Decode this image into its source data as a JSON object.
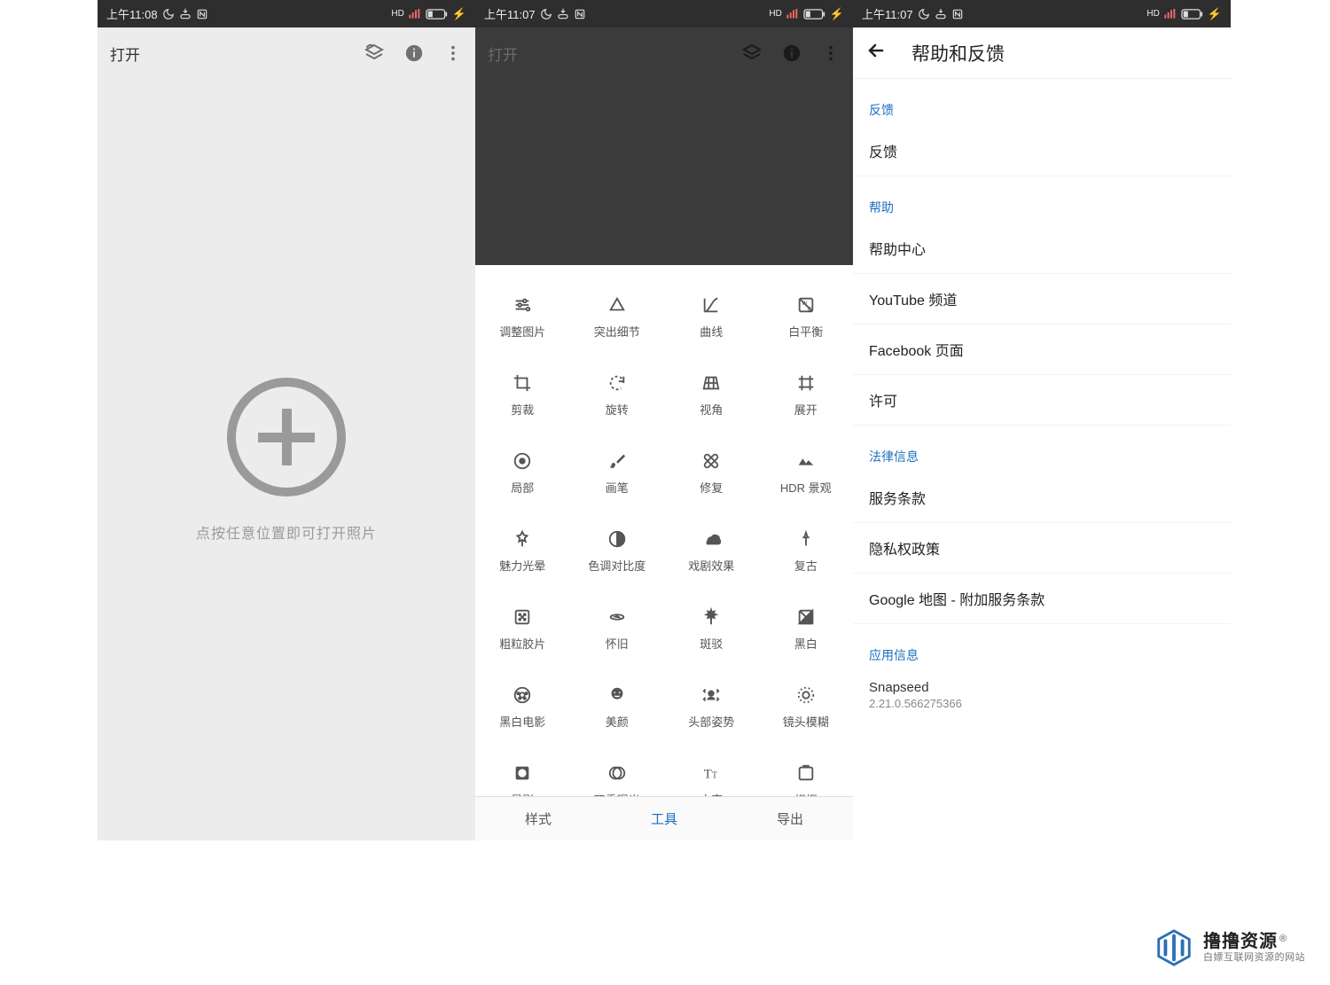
{
  "statusbar": {
    "time1": "上午11:08",
    "time2": "上午11:07",
    "time3": "上午11:07",
    "hd": "HD",
    "batt": "⚡"
  },
  "p1": {
    "open_label": "打开",
    "hint": "点按任意位置即可打开照片"
  },
  "p2": {
    "open_label": "打开",
    "tabs": {
      "styles": "样式",
      "tools": "工具",
      "export": "导出"
    },
    "tools": [
      "调整图片",
      "突出细节",
      "曲线",
      "白平衡",
      "剪裁",
      "旋转",
      "视角",
      "展开",
      "局部",
      "画笔",
      "修复",
      "HDR 景观",
      "魅力光晕",
      "色调对比度",
      "戏剧效果",
      "复古",
      "粗粒胶片",
      "怀旧",
      "斑驳",
      "黑白",
      "黑白电影",
      "美颜",
      "头部姿势",
      "镜头模糊",
      "晕影",
      "双重曝光",
      "文字",
      "相框"
    ]
  },
  "p3": {
    "title": "帮助和反馈",
    "sec_feedback": "反馈",
    "sec_help": "帮助",
    "sec_legal": "法律信息",
    "sec_app": "应用信息",
    "feedback": "反馈",
    "help_center": "帮助中心",
    "youtube": "YouTube 频道",
    "facebook": "Facebook 页面",
    "license": "许可",
    "tos": "服务条款",
    "privacy": "隐私权政策",
    "gmaps": "Google 地图 - 附加服务条款",
    "appname": "Snapseed",
    "appver": "2.21.0.566275366"
  },
  "watermark": {
    "main": "撸撸资源",
    "sub": "白嫖互联网资源的网站",
    "reg": "®"
  }
}
